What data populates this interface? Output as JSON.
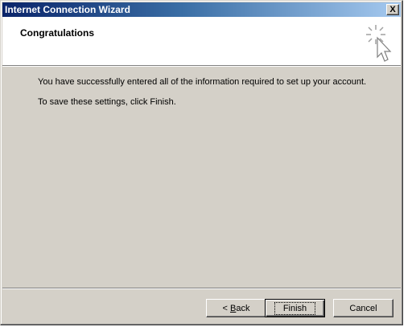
{
  "window": {
    "title": "Internet Connection Wizard",
    "close_label": "X"
  },
  "header": {
    "title": "Congratulations",
    "icon": "wizard-sparkle-cursor-icon"
  },
  "body": {
    "line1": "You have successfully entered all of the information required to set up your account.",
    "line2": "To save these settings, click Finish."
  },
  "buttons": {
    "back_prefix": "< ",
    "back_mnemonic": "B",
    "back_rest": "ack",
    "finish": "Finish",
    "cancel": "Cancel"
  },
  "colors": {
    "titlebar_start": "#0a246a",
    "titlebar_end": "#a6caf0",
    "face": "#d4d0c8"
  }
}
